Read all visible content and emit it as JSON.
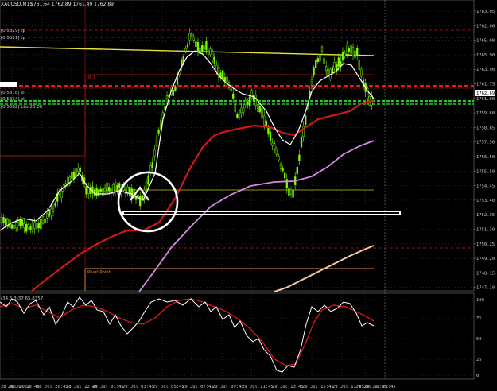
{
  "header": {
    "symbol_title": "XAUUSD,M15",
    "ohlc": "1761.64 1762.89 1761.49 1762.89",
    "subwindow_title": "(34,6,3)37 65.8357"
  },
  "left_labels": [
    {
      "text": "[0.5329] tp"
    },
    {
      "text": "[0.5521] tp"
    },
    {
      "text": "[0.5378] sl"
    },
    {
      "text": "[0.5334] sl"
    },
    {
      "text": "[0.5562] Lbs 25.00"
    }
  ],
  "chart_labels": {
    "r1": "R 1",
    "pivot": "Pivot Point"
  },
  "price_axis": {
    "ticks": [
      "1763.05",
      "1762.00",
      "1765.00",
      "1765.90",
      "1763.90",
      "1761.75",
      "1761.00",
      "1759.60",
      "1758.85",
      "1757.50",
      "1756.50",
      "1755.50",
      "1754.45",
      "1753.40",
      "1752.35",
      "1751.30",
      "1750.25",
      "1749.20",
      "1748.15",
      "1747.10"
    ],
    "current": "1762.69"
  },
  "osc_axis": {
    "ticks": [
      "100",
      "75",
      "50",
      "25",
      "0"
    ]
  },
  "time_axis": {
    "ticks": [
      "28 Jul 2022",
      "28 Jul 18:45",
      "28 Jul 20:45",
      "28 Jul 22:45",
      "29 Jul 01:45",
      "29 Jul 03:45",
      "29 Jul 05:45",
      "29 Jul 07:45",
      "29 Jul 09:45",
      "29 Jul 11:45",
      "29 Jul 13:45",
      "29 Jul 15:45",
      "29 Jul 17:45",
      "29 Jul 19:45",
      "29 Jul 21:45"
    ]
  },
  "colors": {
    "candles": "#7cfc00",
    "ma_fast": "#ffffff",
    "ma_red": "#d01818",
    "ma_violet": "#d888e8",
    "ma_peach": "#f4c8a8",
    "level_yellow": "#e8e040",
    "level_red": "#c01818",
    "level_green": "#22cc22",
    "pivot": "#e08830"
  }
}
